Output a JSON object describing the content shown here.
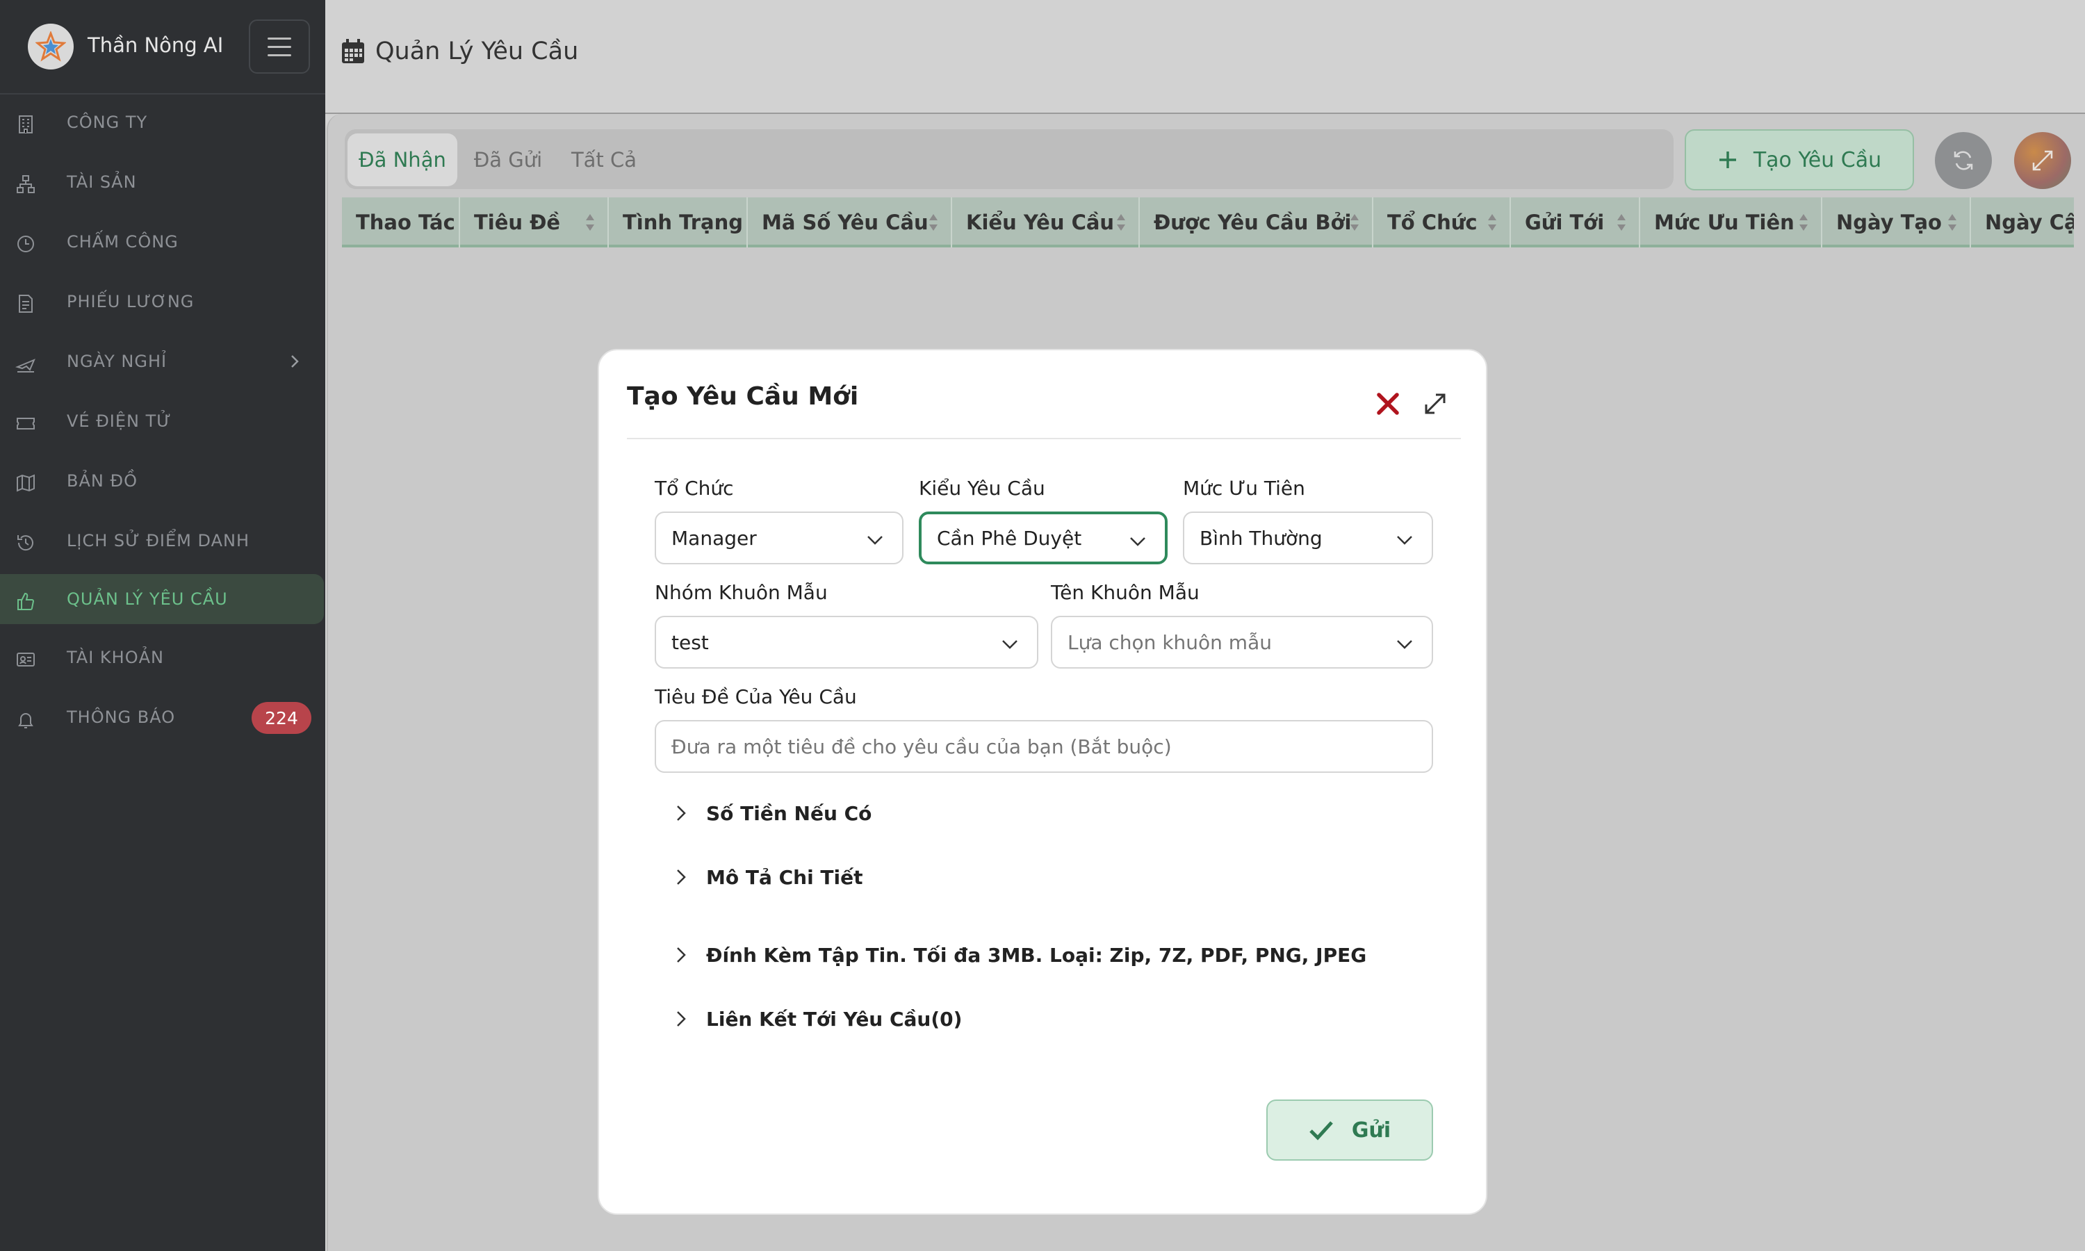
{
  "sidebar": {
    "brand_name": "Thần Nông AI",
    "items": [
      {
        "label": "CÔNG TY",
        "icon": "building-icon"
      },
      {
        "label": "TÀI SẢN",
        "icon": "sitemap-icon"
      },
      {
        "label": "CHẤM CÔNG",
        "icon": "clock-icon"
      },
      {
        "label": "PHIẾU LƯƠNG",
        "icon": "payslip-icon"
      },
      {
        "label": "NGÀY NGHỈ",
        "icon": "plane-icon"
      },
      {
        "label": "VÉ ĐIỆN TỬ",
        "icon": "ticket-icon"
      },
      {
        "label": "BẢN ĐỒ",
        "icon": "map-icon"
      },
      {
        "label": "LỊCH SỬ ĐIỂM DANH",
        "icon": "history-icon"
      },
      {
        "label": "QUẢN LÝ YÊU CẦU",
        "icon": "thumbs-up-icon"
      },
      {
        "label": "TÀI KHOẢN",
        "icon": "id-card-icon"
      },
      {
        "label": "THÔNG BÁO",
        "icon": "bell-icon"
      }
    ],
    "notification_count": "224"
  },
  "header": {
    "title": "Quản Lý Yêu Cầu"
  },
  "tabs": [
    "Đã Nhận",
    "Đã Gửi",
    "Tất Cả"
  ],
  "toolbar": {
    "create_label": "Tạo Yêu Cầu"
  },
  "table": {
    "columns": [
      "Thao Tác",
      "Tiêu Đề",
      "Tình Trạng",
      "Mã Số Yêu Cầu",
      "Kiểu Yêu Cầu",
      "Được Yêu Cầu Bởi",
      "Tổ Chức",
      "Gửi Tới",
      "Mức Ưu Tiên",
      "Ngày Tạo",
      "Ngày Cập"
    ]
  },
  "modal": {
    "title": "Tạo Yêu Cầu Mới",
    "org_label": "Tổ Chức",
    "org_value": "Manager",
    "type_label": "Kiểu Yêu Cầu",
    "type_value": "Cần Phê Duyệt",
    "priority_label": "Mức Ưu Tiên",
    "priority_value": "Bình Thường",
    "template_group_label": "Nhóm Khuôn Mẫu",
    "template_group_value": "test",
    "template_name_label": "Tên Khuôn Mẫu",
    "template_name_placeholder": "Lựa chọn khuôn mẫu",
    "subject_label": "Tiêu Đề Của Yêu Cầu",
    "subject_placeholder": "Đưa ra một tiêu đề cho yêu cầu của bạn (Bắt buộc)",
    "sections": [
      "Số Tiền Nếu Có",
      "Mô Tả Chi Tiết",
      "Đính Kèm Tập Tin. Tối đa 3MB. Loại: Zip, 7Z, PDF, PNG, JPEG",
      "Liên Kết Tới Yêu Cầu(0)"
    ],
    "submit_label": "Gửi"
  },
  "colors": {
    "accent": "#2f7a52",
    "sidebar_bg": "#2e3033",
    "badge": "#b8444b",
    "close_red": "#b0141e"
  }
}
